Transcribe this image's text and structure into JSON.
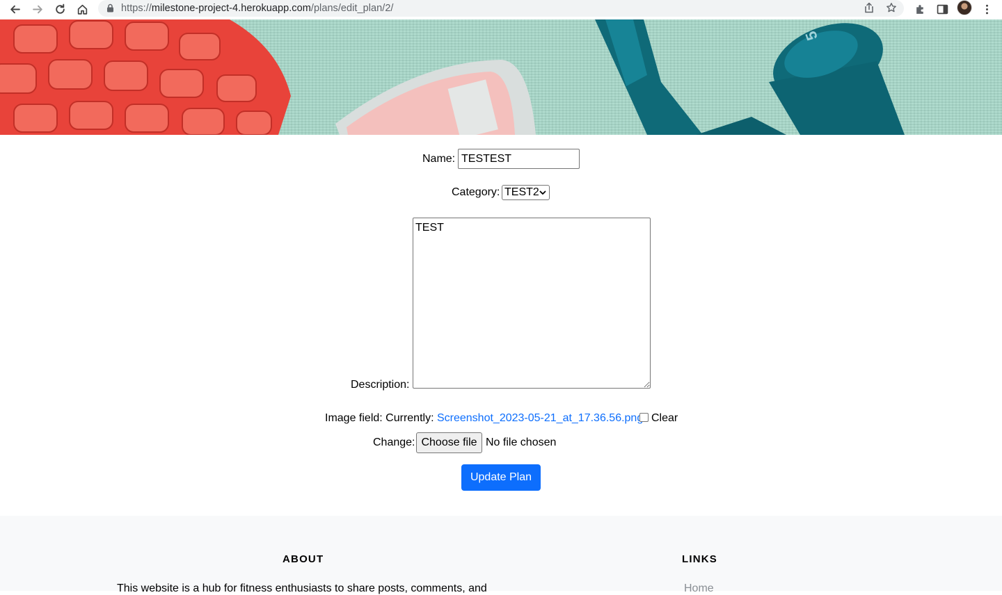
{
  "browser": {
    "url_scheme": "https://",
    "url_host": "milestone-project-4.herokuapp.com",
    "url_path": "/plans/edit_plan/2/"
  },
  "hero": {
    "image_description_icons": [
      "foam-roller",
      "ankle-weight",
      "dumbbell"
    ]
  },
  "form": {
    "name_label": "Name:",
    "name_value": "TESTEST",
    "category_label": "Category:",
    "category_value": "TEST2",
    "description_label": "Description:",
    "description_value": "TEST",
    "image_label": "Image field:",
    "currently_label": "Currently:",
    "current_file": "Screenshot_2023-05-21_at_17.36.56.png",
    "clear_label": "Clear",
    "change_label": "Change:",
    "choose_file_label": "Choose file",
    "no_file_label": "No file chosen",
    "submit_label": "Update Plan"
  },
  "footer": {
    "about_heading": "ABOUT",
    "about_text": "This website is a hub for fitness enthusiasts to share posts, comments, and",
    "links_heading": "LINKS",
    "links": [
      "Home"
    ]
  },
  "colors": {
    "primary": "#0d6efd",
    "footer_bg": "#f8f9fa",
    "hero_mat": "#a6d7c8"
  }
}
